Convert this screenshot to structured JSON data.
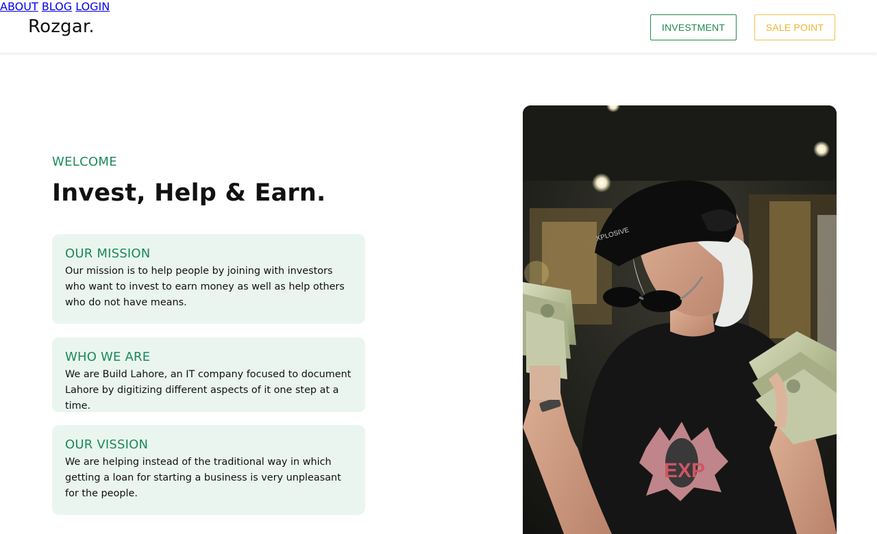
{
  "header": {
    "logo": "Rozgar.",
    "nav": [
      {
        "label": "ABOUT"
      },
      {
        "label": "BLOG"
      },
      {
        "label": "LOGIN"
      }
    ],
    "investment_button": "INVESTMENT",
    "sale_point_button": "SALE POINT"
  },
  "hero": {
    "eyebrow": "WELCOME",
    "headline": "Invest, Help & Earn.",
    "cards": [
      {
        "title": "OUR MISSION",
        "body": "Our mission is to help people by joining with investors who want to invest to earn money as well as help others who do not have means."
      },
      {
        "title": "WHO WE ARE",
        "body": "We are Build Lahore, an IT company focused to document Lahore by digitizing different aspects of it one step at a time."
      },
      {
        "title": "OUR VISSION",
        "body": "We are helping instead of the traditional way in which getting a loan for starting a business is very unpleasant for the people."
      }
    ]
  },
  "photo": {
    "subject": "person in black cap and sunglasses holding cash",
    "shirt_text": "EXP",
    "cap_text": "XPLOSIVE"
  },
  "colors": {
    "accent_green": "#1a8a5a",
    "investment_border": "#1d8a4a",
    "sale_point": "#f0b429",
    "card_bg": "#eaf5f0"
  }
}
